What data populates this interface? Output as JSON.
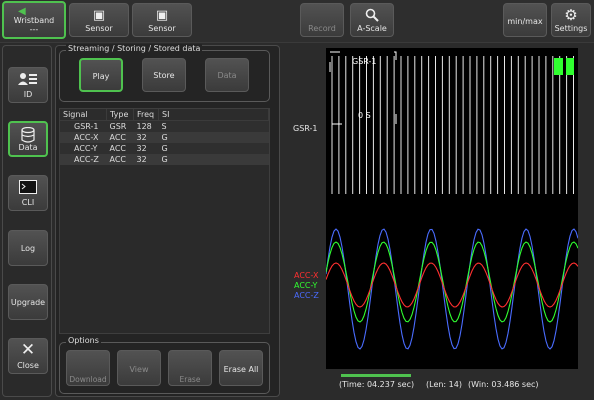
{
  "toolbar": {
    "wristband": {
      "label": "Wristband",
      "sublabel": "---"
    },
    "sensor1": {
      "label": "Sensor"
    },
    "sensor2": {
      "label": "Sensor"
    },
    "record": {
      "label": "Record"
    },
    "ascale": {
      "label": "A-Scale"
    },
    "minmax": {
      "label": "min/max"
    },
    "settings": {
      "label": "Settings"
    }
  },
  "sidebar": {
    "items": [
      {
        "label": "ID"
      },
      {
        "label": "Data"
      },
      {
        "label": "CLI"
      },
      {
        "label": "Log"
      },
      {
        "label": "Upgrade"
      },
      {
        "label": "Close"
      }
    ]
  },
  "streaming": {
    "title": "Streaming / Storing / Stored data",
    "play": "Play",
    "store": "Store",
    "data": "Data"
  },
  "table": {
    "columns": [
      "Signal",
      "Type",
      "Freq",
      "SI"
    ],
    "rows": [
      [
        "GSR-1",
        "GSR",
        "128",
        "S"
      ],
      [
        "ACC-X",
        "ACC",
        "32",
        "G"
      ],
      [
        "ACC-Y",
        "ACC",
        "32",
        "G"
      ],
      [
        "ACC-Z",
        "ACC",
        "32",
        "G"
      ]
    ]
  },
  "options": {
    "title": "Options",
    "download": "Download",
    "view": "View",
    "erase": "Erase",
    "erase_all": "Erase All"
  },
  "plot": {
    "gsr_label": "GSR-1",
    "overlay_label": "GSR-1",
    "overlay_value": "0 S",
    "acc_labels": [
      {
        "text": "ACC-X",
        "color": "#ff3030"
      },
      {
        "text": "ACC-Y",
        "color": "#30ff30"
      },
      {
        "text": "ACC-Z",
        "color": "#4a6cff"
      }
    ]
  },
  "status": {
    "time": "(Time: 04.237 sec)",
    "len": "(Len: 14)",
    "win": "(Win: 03.486 sec)"
  },
  "colors": {
    "accent": "#4fc24f",
    "accx": "#ff3030",
    "accy": "#30ff30",
    "accz": "#4a6cff"
  }
}
